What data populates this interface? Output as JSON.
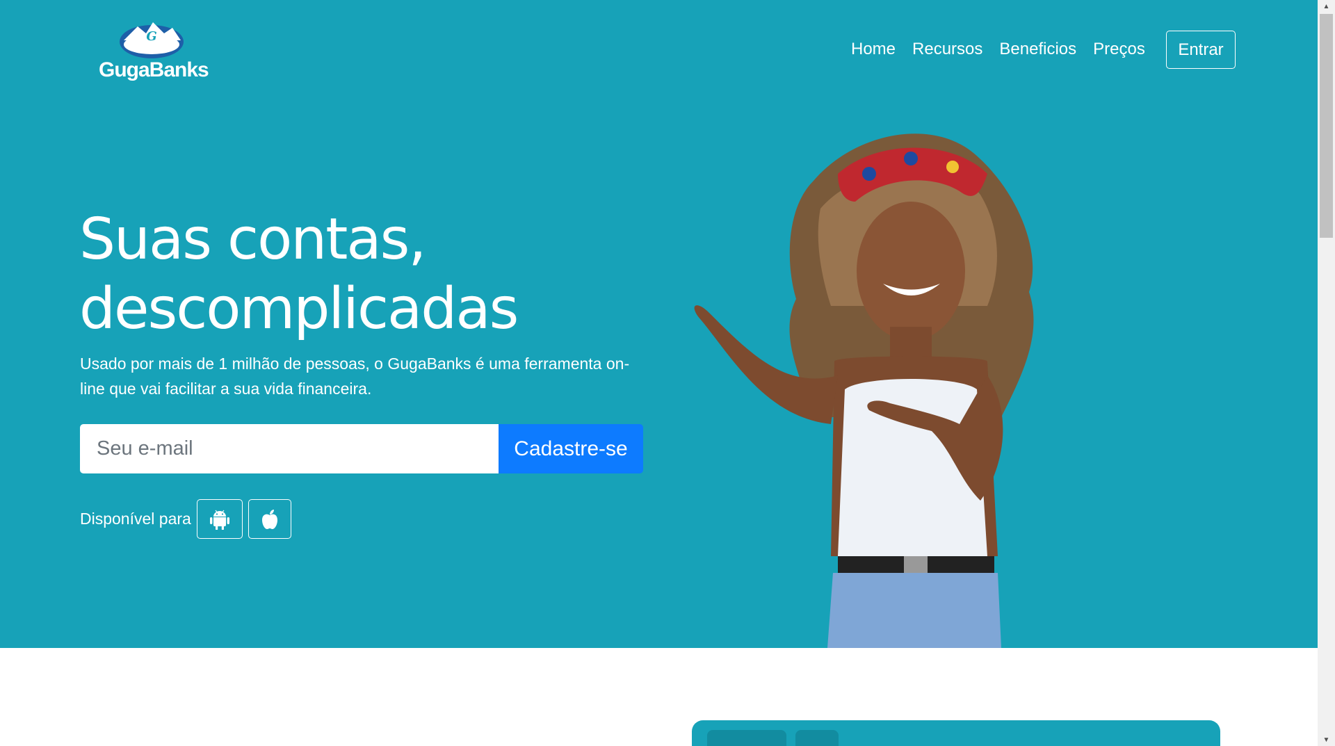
{
  "brand": {
    "name": "GugaBanks"
  },
  "nav": {
    "links": [
      "Home",
      "Recursos",
      "Beneficios",
      "Preços"
    ],
    "login_label": "Entrar"
  },
  "hero": {
    "headline": "Suas contas, descomplicadas",
    "lead": "Usado por mais de 1 milhão de pessoas, o GugaBanks é uma ferramenta on-line que vai facilitar a sua vida financeira.",
    "email_placeholder": "Seu e-mail",
    "signup_label": "Cadastre-se",
    "available_label": "Disponível para",
    "stores": [
      "android-icon",
      "apple-icon"
    ]
  },
  "colors": {
    "hero_bg": "#17a2b8",
    "primary": "#0d7bff",
    "white": "#ffffff"
  }
}
